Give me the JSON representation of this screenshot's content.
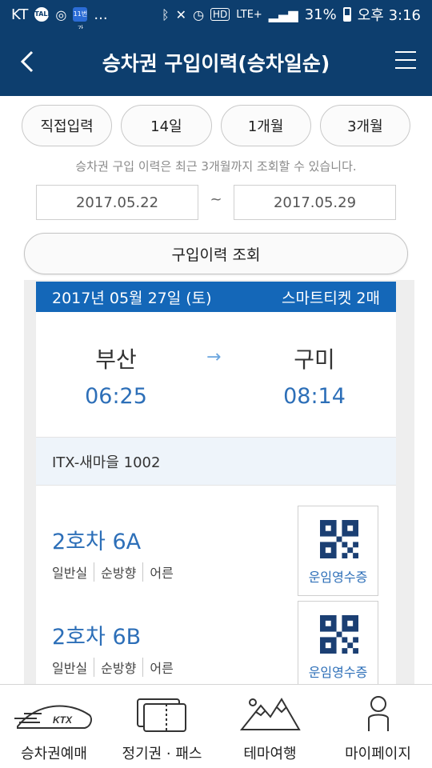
{
  "status_bar": {
    "carrier": "KT",
    "talk_icon_text": "TALK",
    "app_badge_text": "11번가",
    "more": "...",
    "network": "LTE+",
    "battery": "31%",
    "time": "오후 3:16"
  },
  "header": {
    "title": "승차권 구입이력(승차일순)"
  },
  "filters": {
    "options": [
      "직접입력",
      "14일",
      "1개월",
      "3개월"
    ]
  },
  "notice": "승차권 구입 이력은 최근 3개월까지 조회할 수 있습니다.",
  "date_range": {
    "start": "2017.05.22",
    "separator": "~",
    "end": "2017.05.29"
  },
  "search_button": "구입이력 조회",
  "ticket": {
    "date": "2017년 05월 27일 (토)",
    "ticket_count": "스마트티켓 2매",
    "from_station": "부산",
    "from_time": "06:25",
    "arrow": "→",
    "to_station": "구미",
    "to_time": "08:14",
    "train": "ITX-새마을 1002",
    "seats": [
      {
        "seat": "2호차 6A",
        "class": "일반실",
        "direction": "순방향",
        "passenger": "어른",
        "receipt": "운임영수증"
      },
      {
        "seat": "2호차 6B",
        "class": "일반실",
        "direction": "순방향",
        "passenger": "어른",
        "receipt": "운임영수증"
      }
    ]
  },
  "bottom_nav": {
    "items": [
      {
        "label": "승차권예매",
        "icon": "ktx-train-icon",
        "logo_text": "KTX"
      },
      {
        "label": "정기권 · 패스",
        "icon": "pass-cards-icon"
      },
      {
        "label": "테마여행",
        "icon": "mountain-icon"
      },
      {
        "label": "마이페이지",
        "icon": "person-icon"
      }
    ]
  },
  "colors": {
    "header_bg": "#0d3e6e",
    "ticket_header_bg": "#1467b8",
    "accent_blue": "#2d6fb8"
  }
}
